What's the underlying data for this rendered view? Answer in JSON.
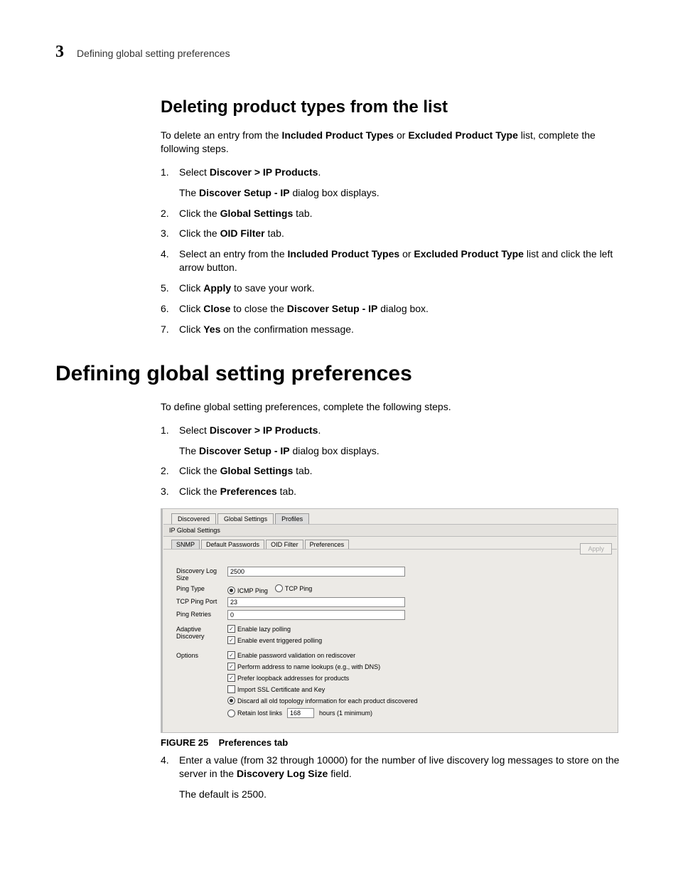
{
  "header": {
    "chapter": "3",
    "running": "Defining global setting preferences"
  },
  "sec1": {
    "title": "Deleting product types from the list",
    "intro_a": "To delete an entry from the ",
    "intro_b": "Included Product Types",
    "intro_c": " or ",
    "intro_d": "Excluded Product Type",
    "intro_e": " list, complete the following steps.",
    "s1a": "Select ",
    "s1b": "Discover > IP Products",
    "s1c": ".",
    "s1suba": "The ",
    "s1subb": "Discover Setup - IP",
    "s1subc": " dialog box displays.",
    "s2a": "Click the ",
    "s2b": "Global Settings",
    "s2c": " tab.",
    "s3a": "Click the ",
    "s3b": "OID Filter",
    "s3c": " tab.",
    "s4a": "Select an entry from the ",
    "s4b": "Included Product Types",
    "s4c": " or ",
    "s4d": "Excluded Product Type",
    "s4e": " list and click the left arrow button.",
    "s5a": "Click ",
    "s5b": "Apply",
    "s5c": " to save your work.",
    "s6a": "Click ",
    "s6b": "Close",
    "s6c": " to close the ",
    "s6d": "Discover Setup - IP",
    "s6e": " dialog box.",
    "s7a": "Click ",
    "s7b": "Yes",
    "s7c": " on the confirmation message."
  },
  "sec2": {
    "title": "Defining global setting preferences",
    "intro": "To define global setting preferences, complete the following steps.",
    "s1a": "Select ",
    "s1b": "Discover > IP Products",
    "s1c": ".",
    "s1suba": "The ",
    "s1subb": "Discover Setup - IP",
    "s1subc": " dialog box displays.",
    "s2a": "Click the ",
    "s2b": "Global Settings",
    "s2c": " tab.",
    "s3a": "Click the ",
    "s3b": "Preferences",
    "s3c": " tab.",
    "fig_label": "FIGURE 25",
    "fig_title": "Preferences tab",
    "s4a": "Enter a value (from 32 through 10000) for the number of live discovery log messages to store on the server in the ",
    "s4b": "Discovery Log Size",
    "s4c": " field.",
    "s4sub": "The default is 2500."
  },
  "dlg": {
    "tabs_outer": {
      "a": "Discovered",
      "b": "Global Settings",
      "c": "Profiles"
    },
    "section_title": "IP Global Settings",
    "tabs_inner": {
      "a": "SNMP",
      "b": "Default Passwords",
      "c": "OID Filter",
      "d": "Preferences"
    },
    "apply": "Apply",
    "rows": {
      "log_label": "Discovery Log Size",
      "log_value": "2500",
      "ping_type_label": "Ping Type",
      "ping_icmp": "ICMP Ping",
      "ping_tcp": "TCP Ping",
      "tcp_port_label": "TCP Ping Port",
      "tcp_port_value": "23",
      "retries_label": "Ping Retries",
      "retries_value": "0",
      "adaptive_label": "Adaptive Discovery",
      "adaptive_a": "Enable lazy polling",
      "adaptive_b": "Enable event triggered polling",
      "options_label": "Options",
      "opt_a": "Enable password validation on rediscover",
      "opt_b": "Perform address to name lookups (e.g., with DNS)",
      "opt_c": "Prefer loopback addresses for products",
      "opt_d": "Import SSL Certificate and Key",
      "opt_e": "Discard all old topology information for each product discovered",
      "opt_f_pre": "Retain lost links",
      "opt_f_val": "168",
      "opt_f_post": "hours (1 minimum)"
    }
  }
}
